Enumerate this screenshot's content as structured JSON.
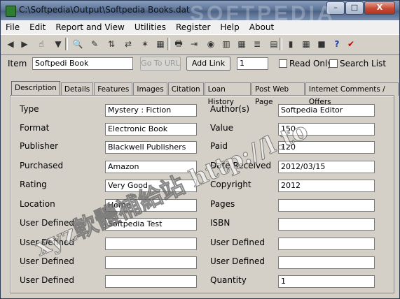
{
  "window": {
    "title": "C:\\Softpedia\\Output\\Softpedia Books.dat",
    "minimize": "–",
    "maximize": "□",
    "close": "X"
  },
  "menu": [
    "File",
    "Edit",
    "Report and View",
    "Utilities",
    "Register",
    "Help",
    "About"
  ],
  "toolbar_icons": [
    "first-record-icon",
    "prev-record-icon",
    "pointer-icon",
    "book-icon",
    "find-icon",
    "edit-icon",
    "sort-icon",
    "swap-icon",
    "magic-icon",
    "database-icon",
    "print-icon",
    "export-icon",
    "camera-icon",
    "chart-icon",
    "table-icon",
    "list-icon",
    "report-icon",
    "calculator-icon",
    "calendar-icon",
    "save-icon",
    "help-icon",
    "check-icon"
  ],
  "toolbar_glyphs": [
    "◀",
    "▶",
    "☝",
    "▼",
    "🔍",
    "✎",
    "⇅",
    "⇄",
    "✶",
    "▦",
    "🖶",
    "⇥",
    "◉",
    "▥",
    "▦",
    "≣",
    "▤",
    "▮",
    "▦",
    "■",
    "?",
    "✔"
  ],
  "itembar": {
    "item_label": "Item",
    "item_value": "Softpedi Book",
    "go_to_url": "Go To URL",
    "add_link": "Add Link",
    "record_number": "1",
    "read_only": "Read Only",
    "search_list": "Search List"
  },
  "tabs": [
    "Description",
    "Details",
    "Features",
    "Images",
    "Citation",
    "Loan History",
    "Post Web Page",
    "Internet Comments / Offers"
  ],
  "active_tab": "Description",
  "left_fields": [
    {
      "label": "Type",
      "value": "Mystery : Fiction"
    },
    {
      "label": "Format",
      "value": "Electronic Book"
    },
    {
      "label": "Publisher",
      "value": "Blackwell Publishers"
    },
    {
      "label": "Purchased",
      "value": "Amazon"
    },
    {
      "label": "Rating",
      "value": "Very Good"
    },
    {
      "label": "Location",
      "value": "Home"
    },
    {
      "label": "User Defined",
      "value": "Softpedia Test"
    },
    {
      "label": "User Defined",
      "value": ""
    },
    {
      "label": "User Defined",
      "value": ""
    },
    {
      "label": "User Defined",
      "value": ""
    }
  ],
  "right_fields": [
    {
      "label": "Author(s)",
      "value": "Softpedia Editor"
    },
    {
      "label": "Value",
      "value": "150"
    },
    {
      "label": "Paid",
      "value": "120"
    },
    {
      "label": "Date Received",
      "value": "2012/03/15"
    },
    {
      "label": "Copyright",
      "value": "2012"
    },
    {
      "label": "Pages",
      "value": ""
    },
    {
      "label": "ISBN",
      "value": ""
    },
    {
      "label": "User Defined",
      "value": ""
    },
    {
      "label": "User Defined",
      "value": ""
    },
    {
      "label": "Quantity",
      "value": "1"
    }
  ],
  "watermark": {
    "logo": "SOFTPEDIA",
    "overlay": "xyz軟體補給站 http://l.to"
  }
}
